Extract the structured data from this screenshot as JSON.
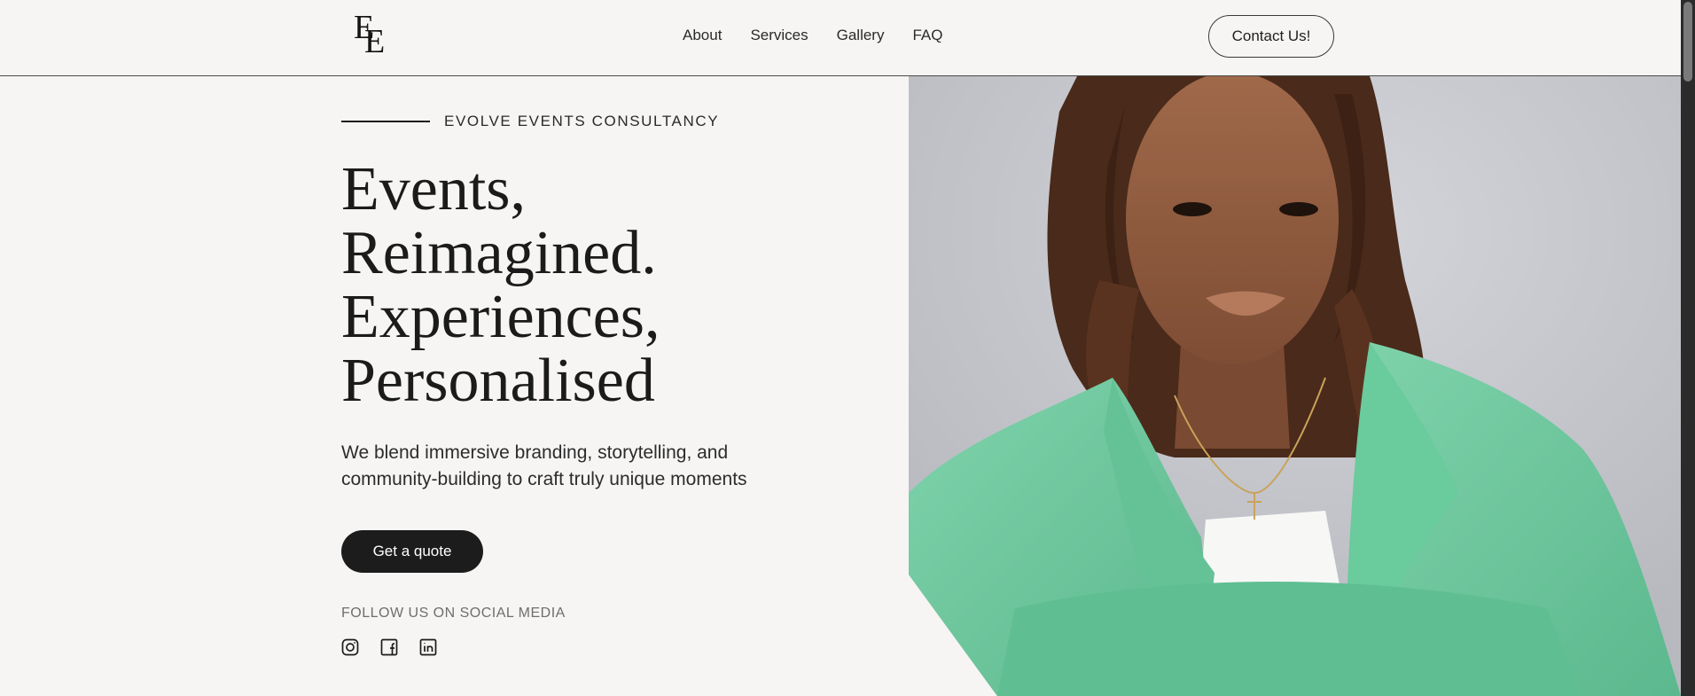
{
  "header": {
    "logo_text": [
      "E",
      "E"
    ],
    "nav": [
      {
        "label": "About"
      },
      {
        "label": "Services"
      },
      {
        "label": "Gallery"
      },
      {
        "label": "FAQ"
      }
    ],
    "contact_label": "Contact Us!"
  },
  "hero": {
    "eyebrow": "EVOLVE EVENTS CONSULTANCY",
    "headline_lines": [
      "Events,",
      "Reimagined.",
      "Experiences,",
      "Personalised"
    ],
    "subtext": "We blend immersive branding, storytelling, and community-building to craft truly unique moments",
    "cta_label": "Get a quote",
    "follow_label": "FOLLOW US ON SOCIAL MEDIA",
    "socials": [
      "instagram-icon",
      "facebook-icon",
      "linkedin-icon"
    ],
    "image_subject": "portrait-photo"
  },
  "colors": {
    "background": "#f6f5f3",
    "text": "#1b1b1b",
    "button_dark": "#1c1c1c",
    "muted": "#6e6e6e",
    "jacket": "#6fc9a0",
    "photo_bg": "#c4c6cc"
  }
}
